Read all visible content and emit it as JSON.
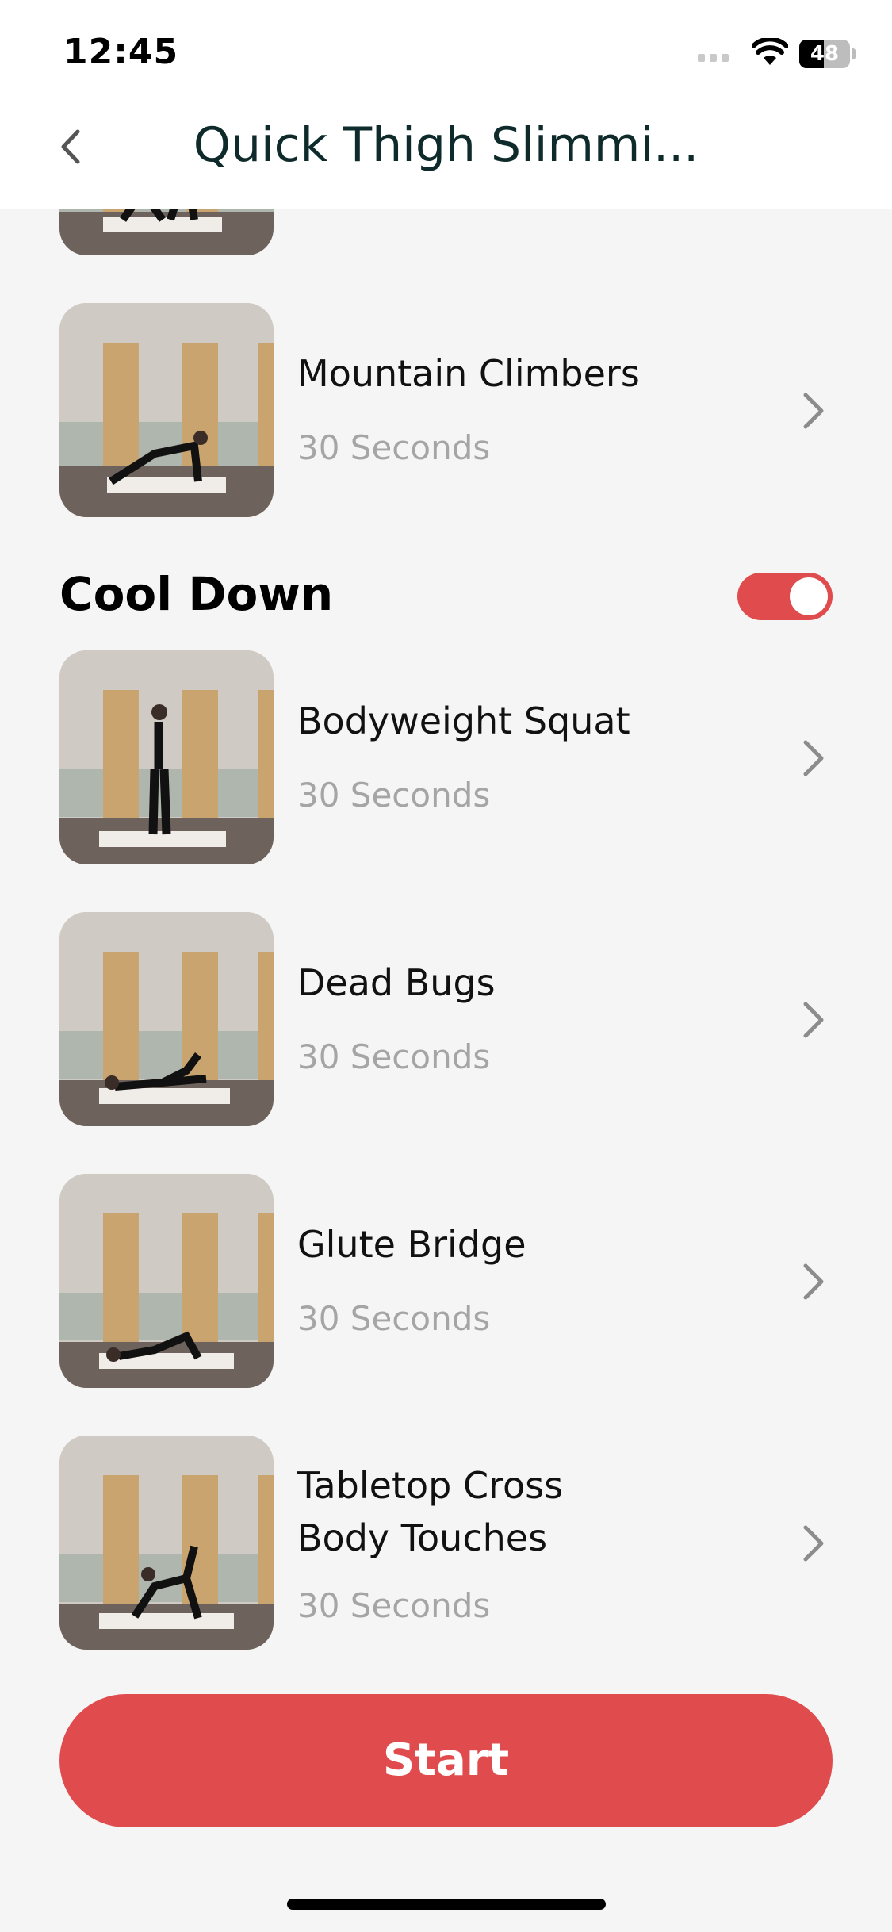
{
  "status_bar": {
    "time": "12:45",
    "battery": "48",
    "battery_level": 0.48
  },
  "header": {
    "title": "Quick Thigh Slimmi..."
  },
  "exercises_top": [
    {
      "name": "Mountain Climbers",
      "duration": "30 Seconds"
    }
  ],
  "cool_down": {
    "title": "Cool Down",
    "enabled": true,
    "items": [
      {
        "name": "Bodyweight Squat",
        "duration": "30 Seconds"
      },
      {
        "name": "Dead Bugs",
        "duration": "30 Seconds"
      },
      {
        "name": "Glute Bridge",
        "duration": "30 Seconds"
      },
      {
        "name_line1": "Tabletop Cross",
        "name_line2": "Body Touches",
        "duration": "30 Seconds"
      }
    ]
  },
  "actions": {
    "start_label": "Start"
  },
  "colors": {
    "accent": "#e04b4d",
    "title": "#0e2a2a",
    "subtle_text": "#a5a5a5",
    "background": "#f5f5f5"
  },
  "icons": [
    "back-chevron-icon",
    "wifi-icon",
    "battery-icon",
    "signal-icon",
    "chevron-right-icon"
  ]
}
